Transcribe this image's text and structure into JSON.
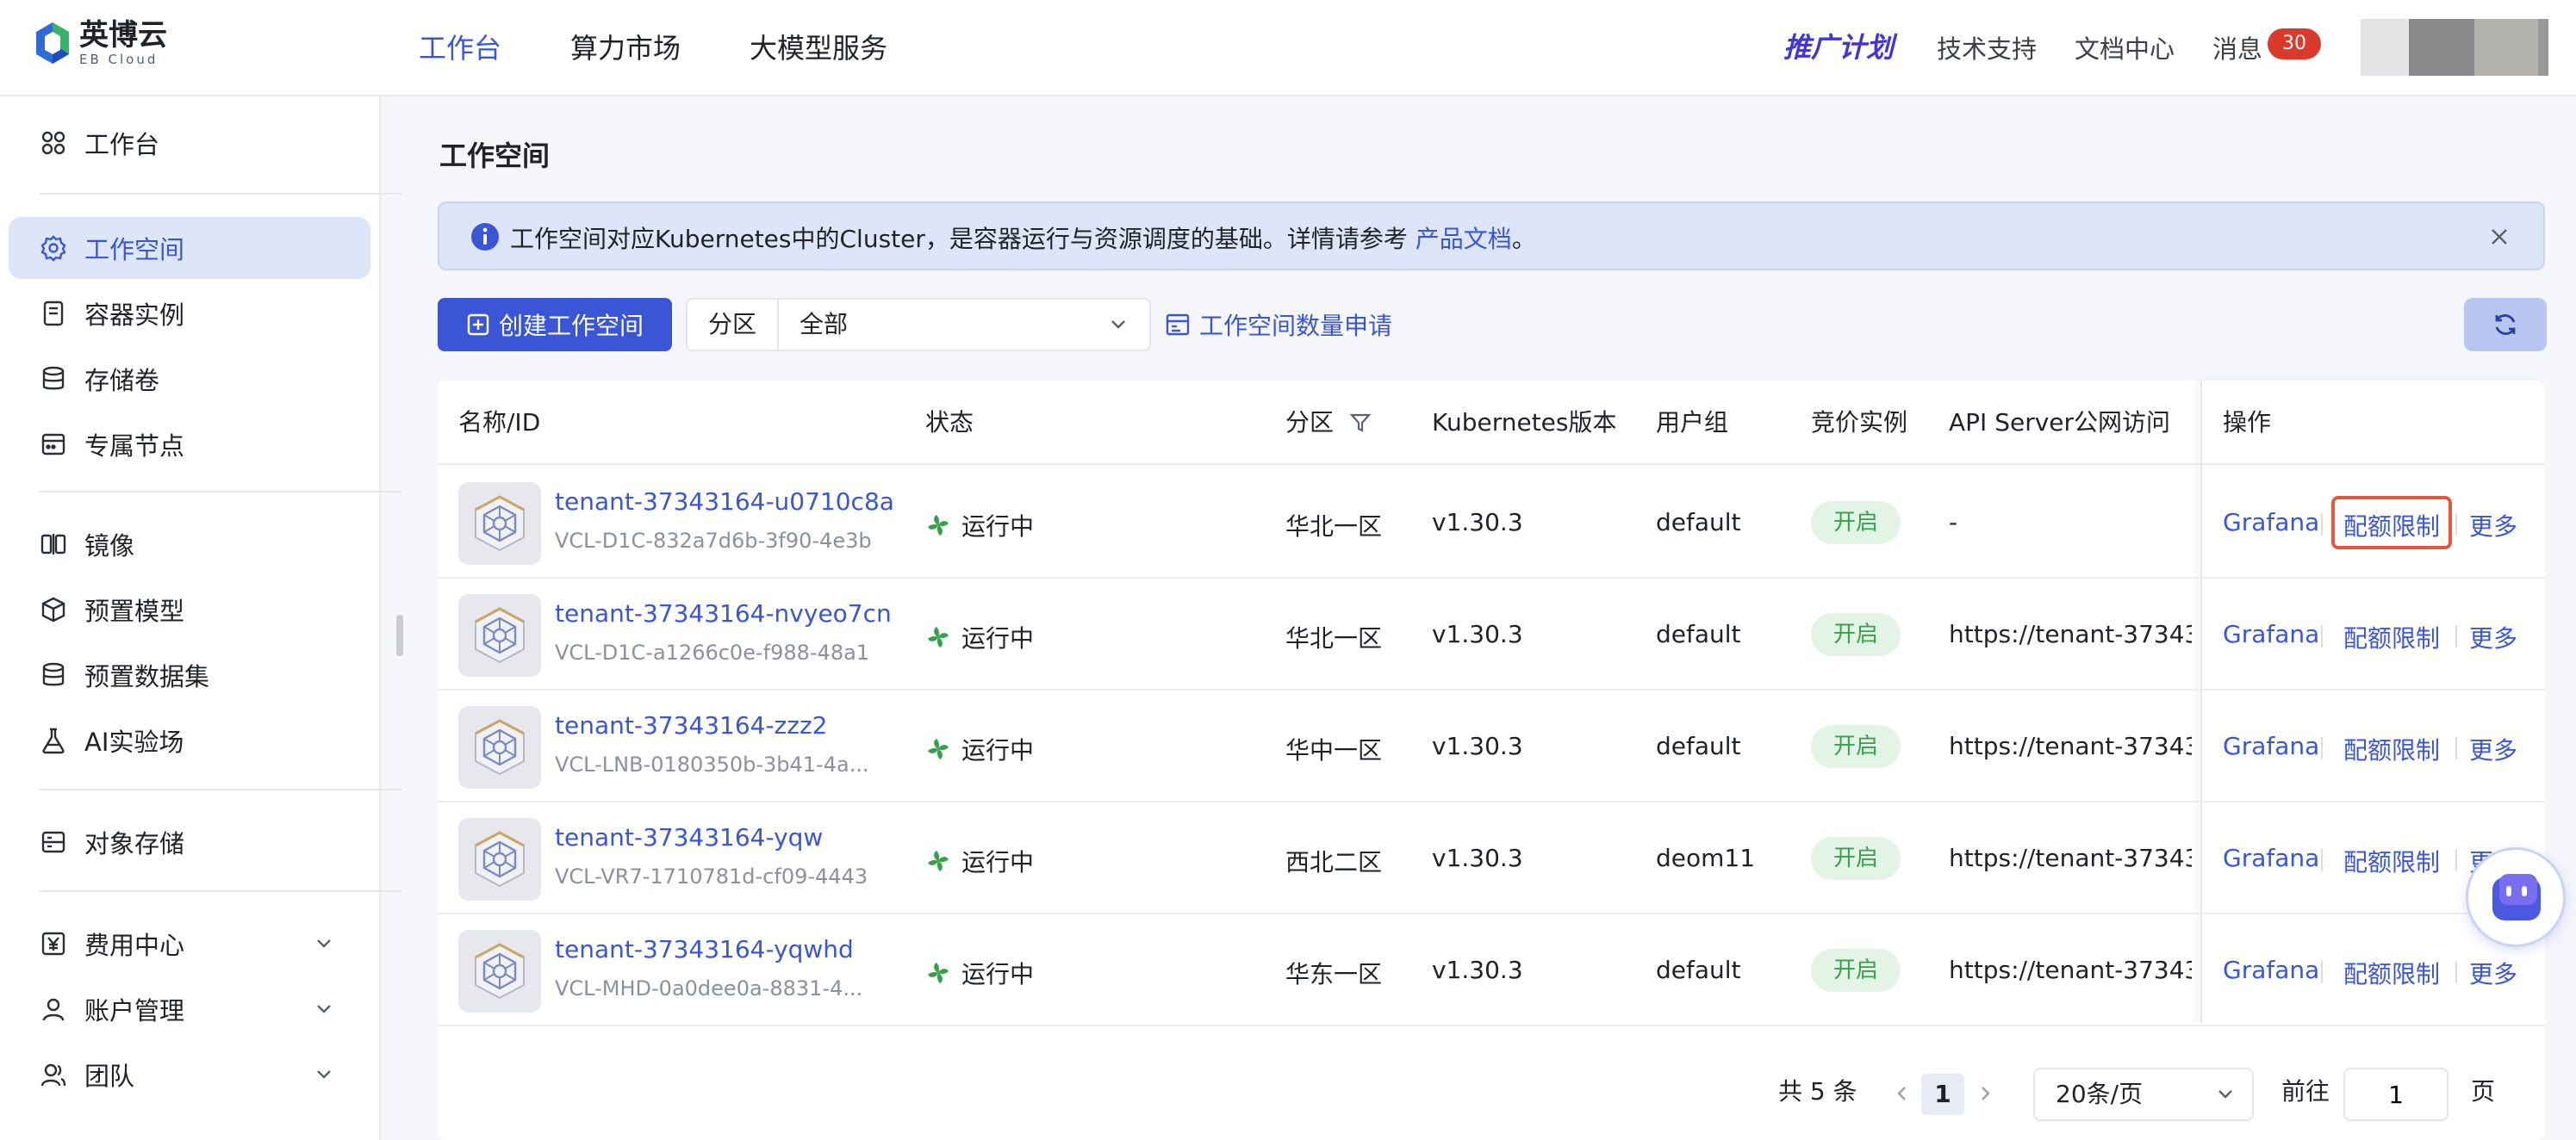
{
  "brand": {
    "name": "英博云",
    "sub": "EB Cloud"
  },
  "topnav": [
    {
      "label": "工作台",
      "active": true
    },
    {
      "label": "算力市场",
      "active": false
    },
    {
      "label": "大模型服务",
      "active": false
    }
  ],
  "header_right": {
    "promo": "推广计划",
    "support": "技术支持",
    "docs": "文档中心",
    "messages": "消息",
    "message_count": "30"
  },
  "sidebar": {
    "items": [
      {
        "label": "工作台",
        "icon": "dashboard-icon"
      },
      {
        "label": "工作空间",
        "icon": "workspace-gear-icon",
        "active": true
      },
      {
        "label": "容器实例",
        "icon": "container-icon"
      },
      {
        "label": "存储卷",
        "icon": "database-icon"
      },
      {
        "label": "专属节点",
        "icon": "node-icon"
      },
      {
        "label": "镜像",
        "icon": "mirror-icon"
      },
      {
        "label": "预置模型",
        "icon": "cube-icon"
      },
      {
        "label": "预置数据集",
        "icon": "dataset-icon"
      },
      {
        "label": "AI实验场",
        "icon": "flask-icon"
      },
      {
        "label": "对象存储",
        "icon": "object-storage-icon"
      },
      {
        "label": "费用中心",
        "icon": "yen-icon",
        "expandable": true
      },
      {
        "label": "账户管理",
        "icon": "user-icon",
        "expandable": true
      },
      {
        "label": "团队",
        "icon": "team-icon",
        "expandable": true
      }
    ]
  },
  "page": {
    "title": "工作空间",
    "banner_text": "工作空间对应Kubernetes中的Cluster，是容器运行与资源调度的基础。详情请参考 ",
    "banner_link": "产品文档",
    "banner_tail": "。",
    "create_button": "创建工作空间",
    "region_label": "分区",
    "region_value": "全部",
    "quota_apply": "工作空间数量申请"
  },
  "table": {
    "columns": [
      "名称/ID",
      "状态",
      "分区",
      "Kubernetes版本",
      "用户组",
      "竞价实例",
      "API Server公网访问",
      "操作"
    ],
    "rows": [
      {
        "name": "tenant-37343164-u0710c8a",
        "id": "VCL-D1C-832a7d6b-3f90-4e3b",
        "status": "运行中",
        "region": "华北一区",
        "k8s": "v1.30.3",
        "group": "default",
        "spot": "开启",
        "api": "-"
      },
      {
        "name": "tenant-37343164-nvyeo7cn",
        "id": "VCL-D1C-a1266c0e-f988-48a1",
        "status": "运行中",
        "region": "华北一区",
        "k8s": "v1.30.3",
        "group": "default",
        "spot": "开启",
        "api": "https://tenant-37343..."
      },
      {
        "name": "tenant-37343164-zzz2",
        "id": "VCL-LNB-0180350b-3b41-4a...",
        "status": "运行中",
        "region": "华中一区",
        "k8s": "v1.30.3",
        "group": "default",
        "spot": "开启",
        "api": "https://tenant-37343..."
      },
      {
        "name": "tenant-37343164-yqw",
        "id": "VCL-VR7-1710781d-cf09-4443",
        "status": "运行中",
        "region": "西北二区",
        "k8s": "v1.30.3",
        "group": "deom11",
        "spot": "开启",
        "api": "https://tenant-37343..."
      },
      {
        "name": "tenant-37343164-yqwhd",
        "id": "VCL-MHD-0a0dee0a-8831-4...",
        "status": "运行中",
        "region": "华东一区",
        "k8s": "v1.30.3",
        "group": "default",
        "spot": "开启",
        "api": "https://tenant-37343..."
      }
    ],
    "ops": {
      "grafana": "Grafana",
      "quota": "配额限制",
      "more": "更多"
    }
  },
  "pagination": {
    "total": "共 5 条",
    "current": "1",
    "page_size": "20条/页",
    "goto_label": "前往",
    "goto_value": "1",
    "page_unit": "页"
  },
  "colors": {
    "accent": "#3a56d6",
    "running": "#37a04b",
    "highlight": "#e4573f",
    "badge": "#d93a2b"
  }
}
